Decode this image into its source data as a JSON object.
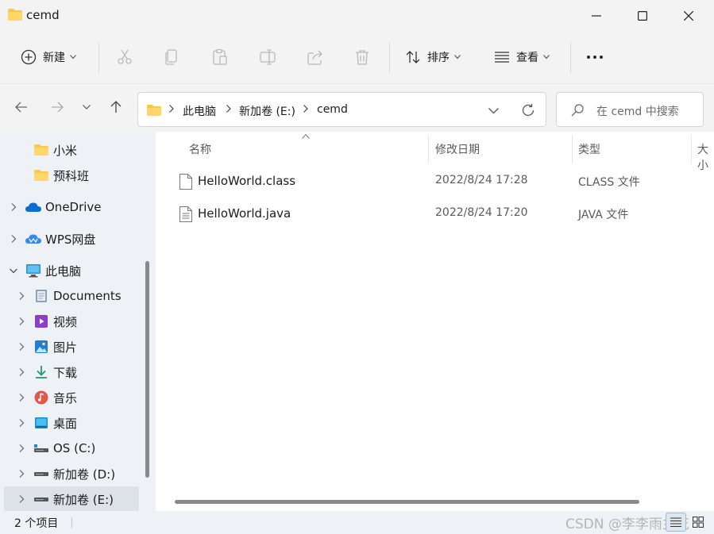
{
  "window": {
    "title": "cemd",
    "minimize": "minimize",
    "maximize": "maximize",
    "close": "close"
  },
  "toolbar": {
    "new_label": "新建",
    "sort_label": "排序",
    "view_label": "查看",
    "more": "more"
  },
  "address": {
    "crumbs": [
      "此电脑",
      "新加卷 (E:)",
      "cemd"
    ]
  },
  "search": {
    "placeholder": "在 cemd 中搜索"
  },
  "sidebar": {
    "items": [
      {
        "label": "小米",
        "icon": "folder-icon"
      },
      {
        "label": "预科班",
        "icon": "folder-icon"
      },
      {
        "label": "OneDrive",
        "icon": "cloud-icon"
      },
      {
        "label": "WPS网盘",
        "icon": "wps-cloud-icon"
      },
      {
        "label": "此电脑",
        "icon": "computer-icon"
      },
      {
        "label": "Documents",
        "icon": "documents-icon"
      },
      {
        "label": "视频",
        "icon": "video-icon"
      },
      {
        "label": "图片",
        "icon": "pictures-icon"
      },
      {
        "label": "下载",
        "icon": "download-icon"
      },
      {
        "label": "音乐",
        "icon": "music-icon"
      },
      {
        "label": "桌面",
        "icon": "desktop-icon"
      },
      {
        "label": "OS (C:)",
        "icon": "drive-icon"
      },
      {
        "label": "新加卷 (D:)",
        "icon": "drive-icon"
      },
      {
        "label": "新加卷 (E:)",
        "icon": "drive-icon"
      }
    ]
  },
  "columns": {
    "name": "名称",
    "date": "修改日期",
    "type": "类型",
    "size": "大小"
  },
  "files": [
    {
      "name": "HelloWorld.class",
      "date": "2022/8/24 17:28",
      "type": "CLASS 文件"
    },
    {
      "name": "HelloWorld.java",
      "date": "2022/8/24 17:20",
      "type": "JAVA 文件"
    }
  ],
  "status": {
    "count": "2 个项目"
  },
  "watermark": "CSDN @李李雨主花",
  "colors": {
    "accent": "#0067c0",
    "folder": "#f7c948",
    "selected": "#dde2e9"
  }
}
